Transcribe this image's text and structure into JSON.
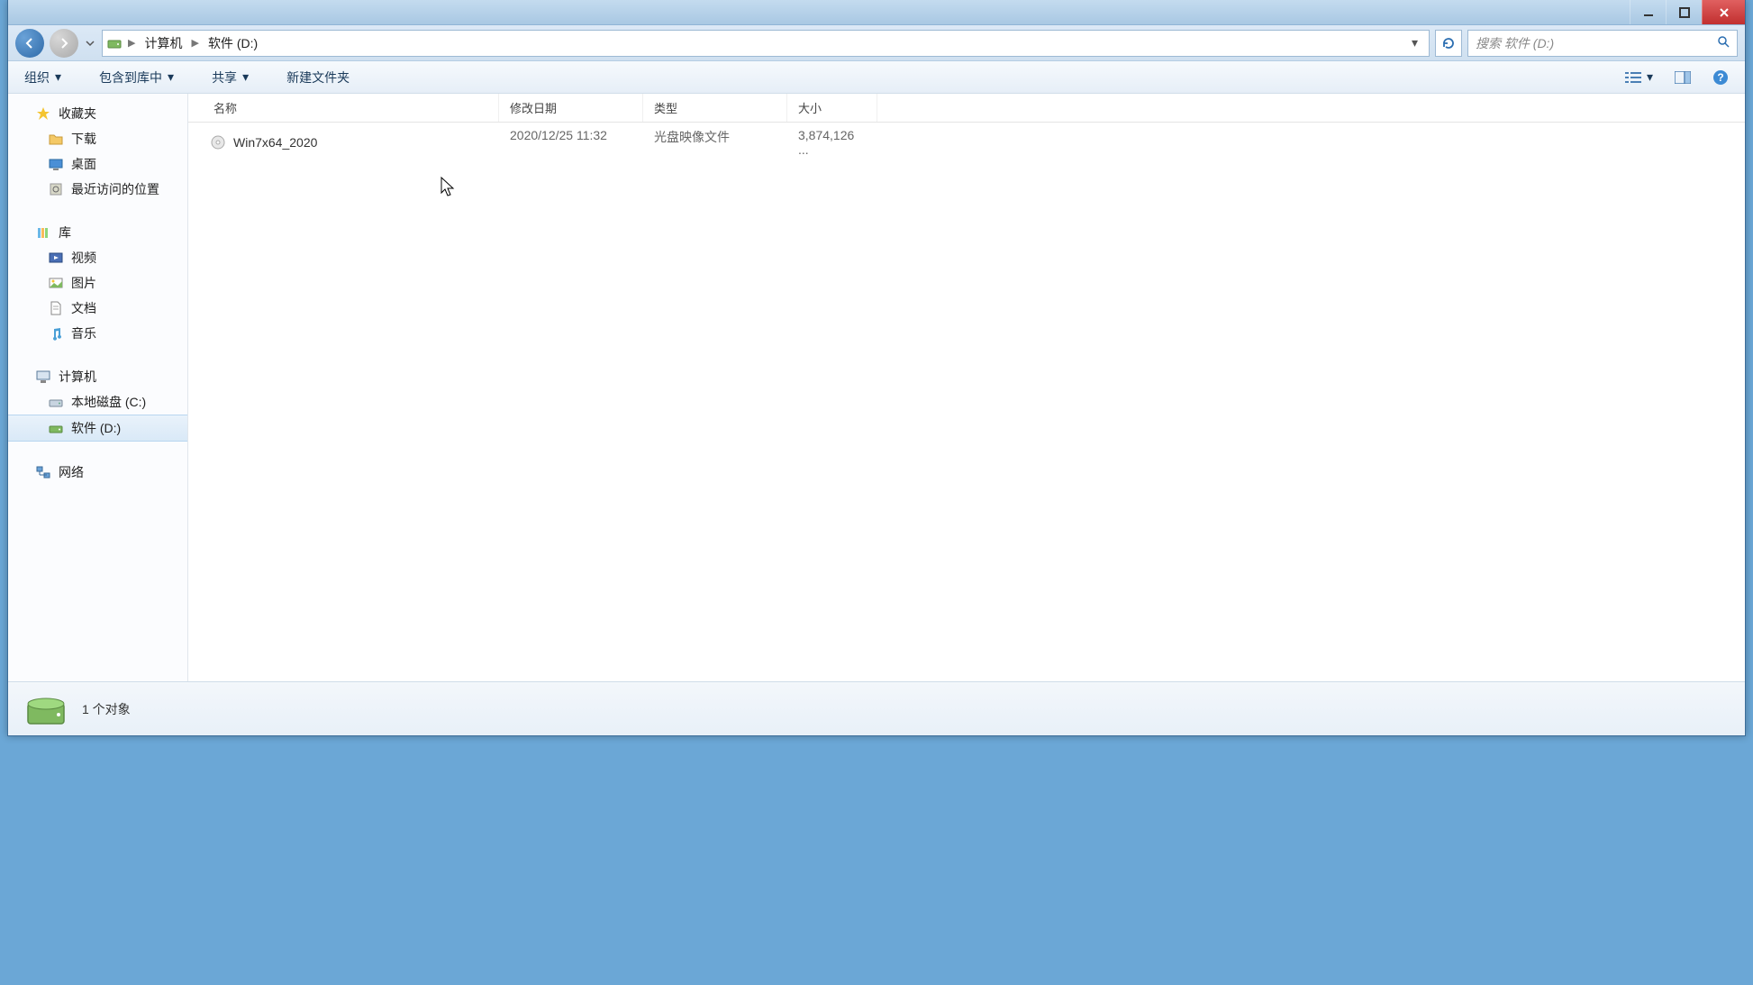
{
  "window": {
    "minimize_tooltip": "Minimize",
    "maximize_tooltip": "Maximize",
    "close_tooltip": "Close"
  },
  "address": {
    "segments": [
      "计算机",
      "软件 (D:)"
    ],
    "search_placeholder": "搜索 软件 (D:)"
  },
  "toolbar": {
    "organize": "组织",
    "include": "包含到库中",
    "share": "共享",
    "newfolder": "新建文件夹"
  },
  "sidebar": {
    "favorites": {
      "label": "收藏夹",
      "items": [
        "下载",
        "桌面",
        "最近访问的位置"
      ]
    },
    "libraries": {
      "label": "库",
      "items": [
        "视频",
        "图片",
        "文档",
        "音乐"
      ]
    },
    "computer": {
      "label": "计算机",
      "items": [
        "本地磁盘 (C:)",
        "软件 (D:)"
      ],
      "selected_index": 1
    },
    "network": {
      "label": "网络"
    }
  },
  "columns": {
    "name": "名称",
    "date": "修改日期",
    "type": "类型",
    "size": "大小"
  },
  "files": [
    {
      "name": "Win7x64_2020",
      "date": "2020/12/25 11:32",
      "type": "光盘映像文件",
      "size": "3,874,126 ..."
    }
  ],
  "statusbar": {
    "text": "1 个对象"
  }
}
